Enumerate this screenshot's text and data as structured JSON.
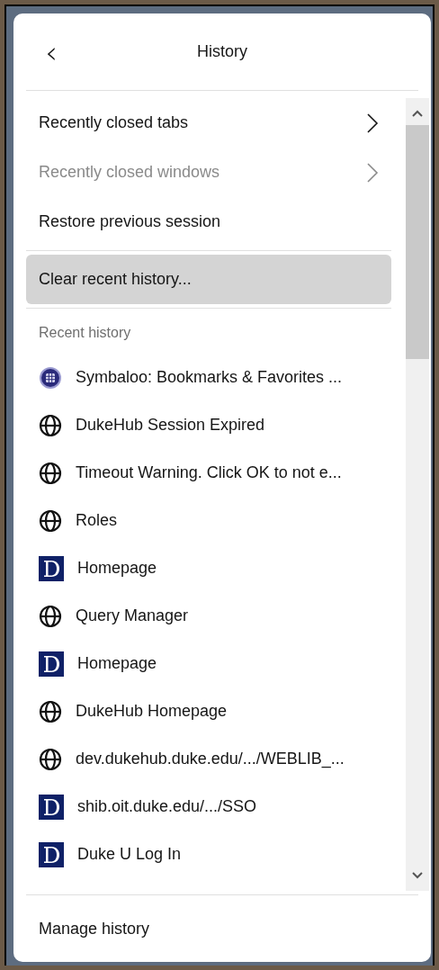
{
  "header": {
    "back_symbol": "‹",
    "title": "History"
  },
  "menu_items": [
    {
      "label": "Recently closed tabs",
      "kind": "submenu",
      "disabled": false
    },
    {
      "label": "Recently closed windows",
      "kind": "submenu",
      "disabled": true
    },
    {
      "label": "Restore previous session",
      "kind": "action",
      "disabled": false
    }
  ],
  "clear_button": {
    "label": "Clear recent history...",
    "highlighted": true
  },
  "recent_history": {
    "heading": "Recent history",
    "items": [
      {
        "title": "Symbaloo: Bookmarks & Favorites ...",
        "kind": "symbaloo"
      },
      {
        "title": "DukeHub Session Expired",
        "kind": "globe"
      },
      {
        "title": "Timeout Warning. Click OK to not e...",
        "kind": "globe"
      },
      {
        "title": "Roles",
        "kind": "globe"
      },
      {
        "title": "Homepage",
        "kind": "duke"
      },
      {
        "title": "Query Manager",
        "kind": "globe"
      },
      {
        "title": "Homepage",
        "kind": "duke"
      },
      {
        "title": "DukeHub Homepage",
        "kind": "globe"
      },
      {
        "title": "dev.dukehub.duke.edu/.../WEBLIB_...",
        "kind": "globe"
      },
      {
        "title": "shib.oit.duke.edu/.../SSO",
        "kind": "duke"
      },
      {
        "title": "Duke U Log In",
        "kind": "duke"
      }
    ]
  },
  "footer": {
    "label": "Manage history"
  }
}
